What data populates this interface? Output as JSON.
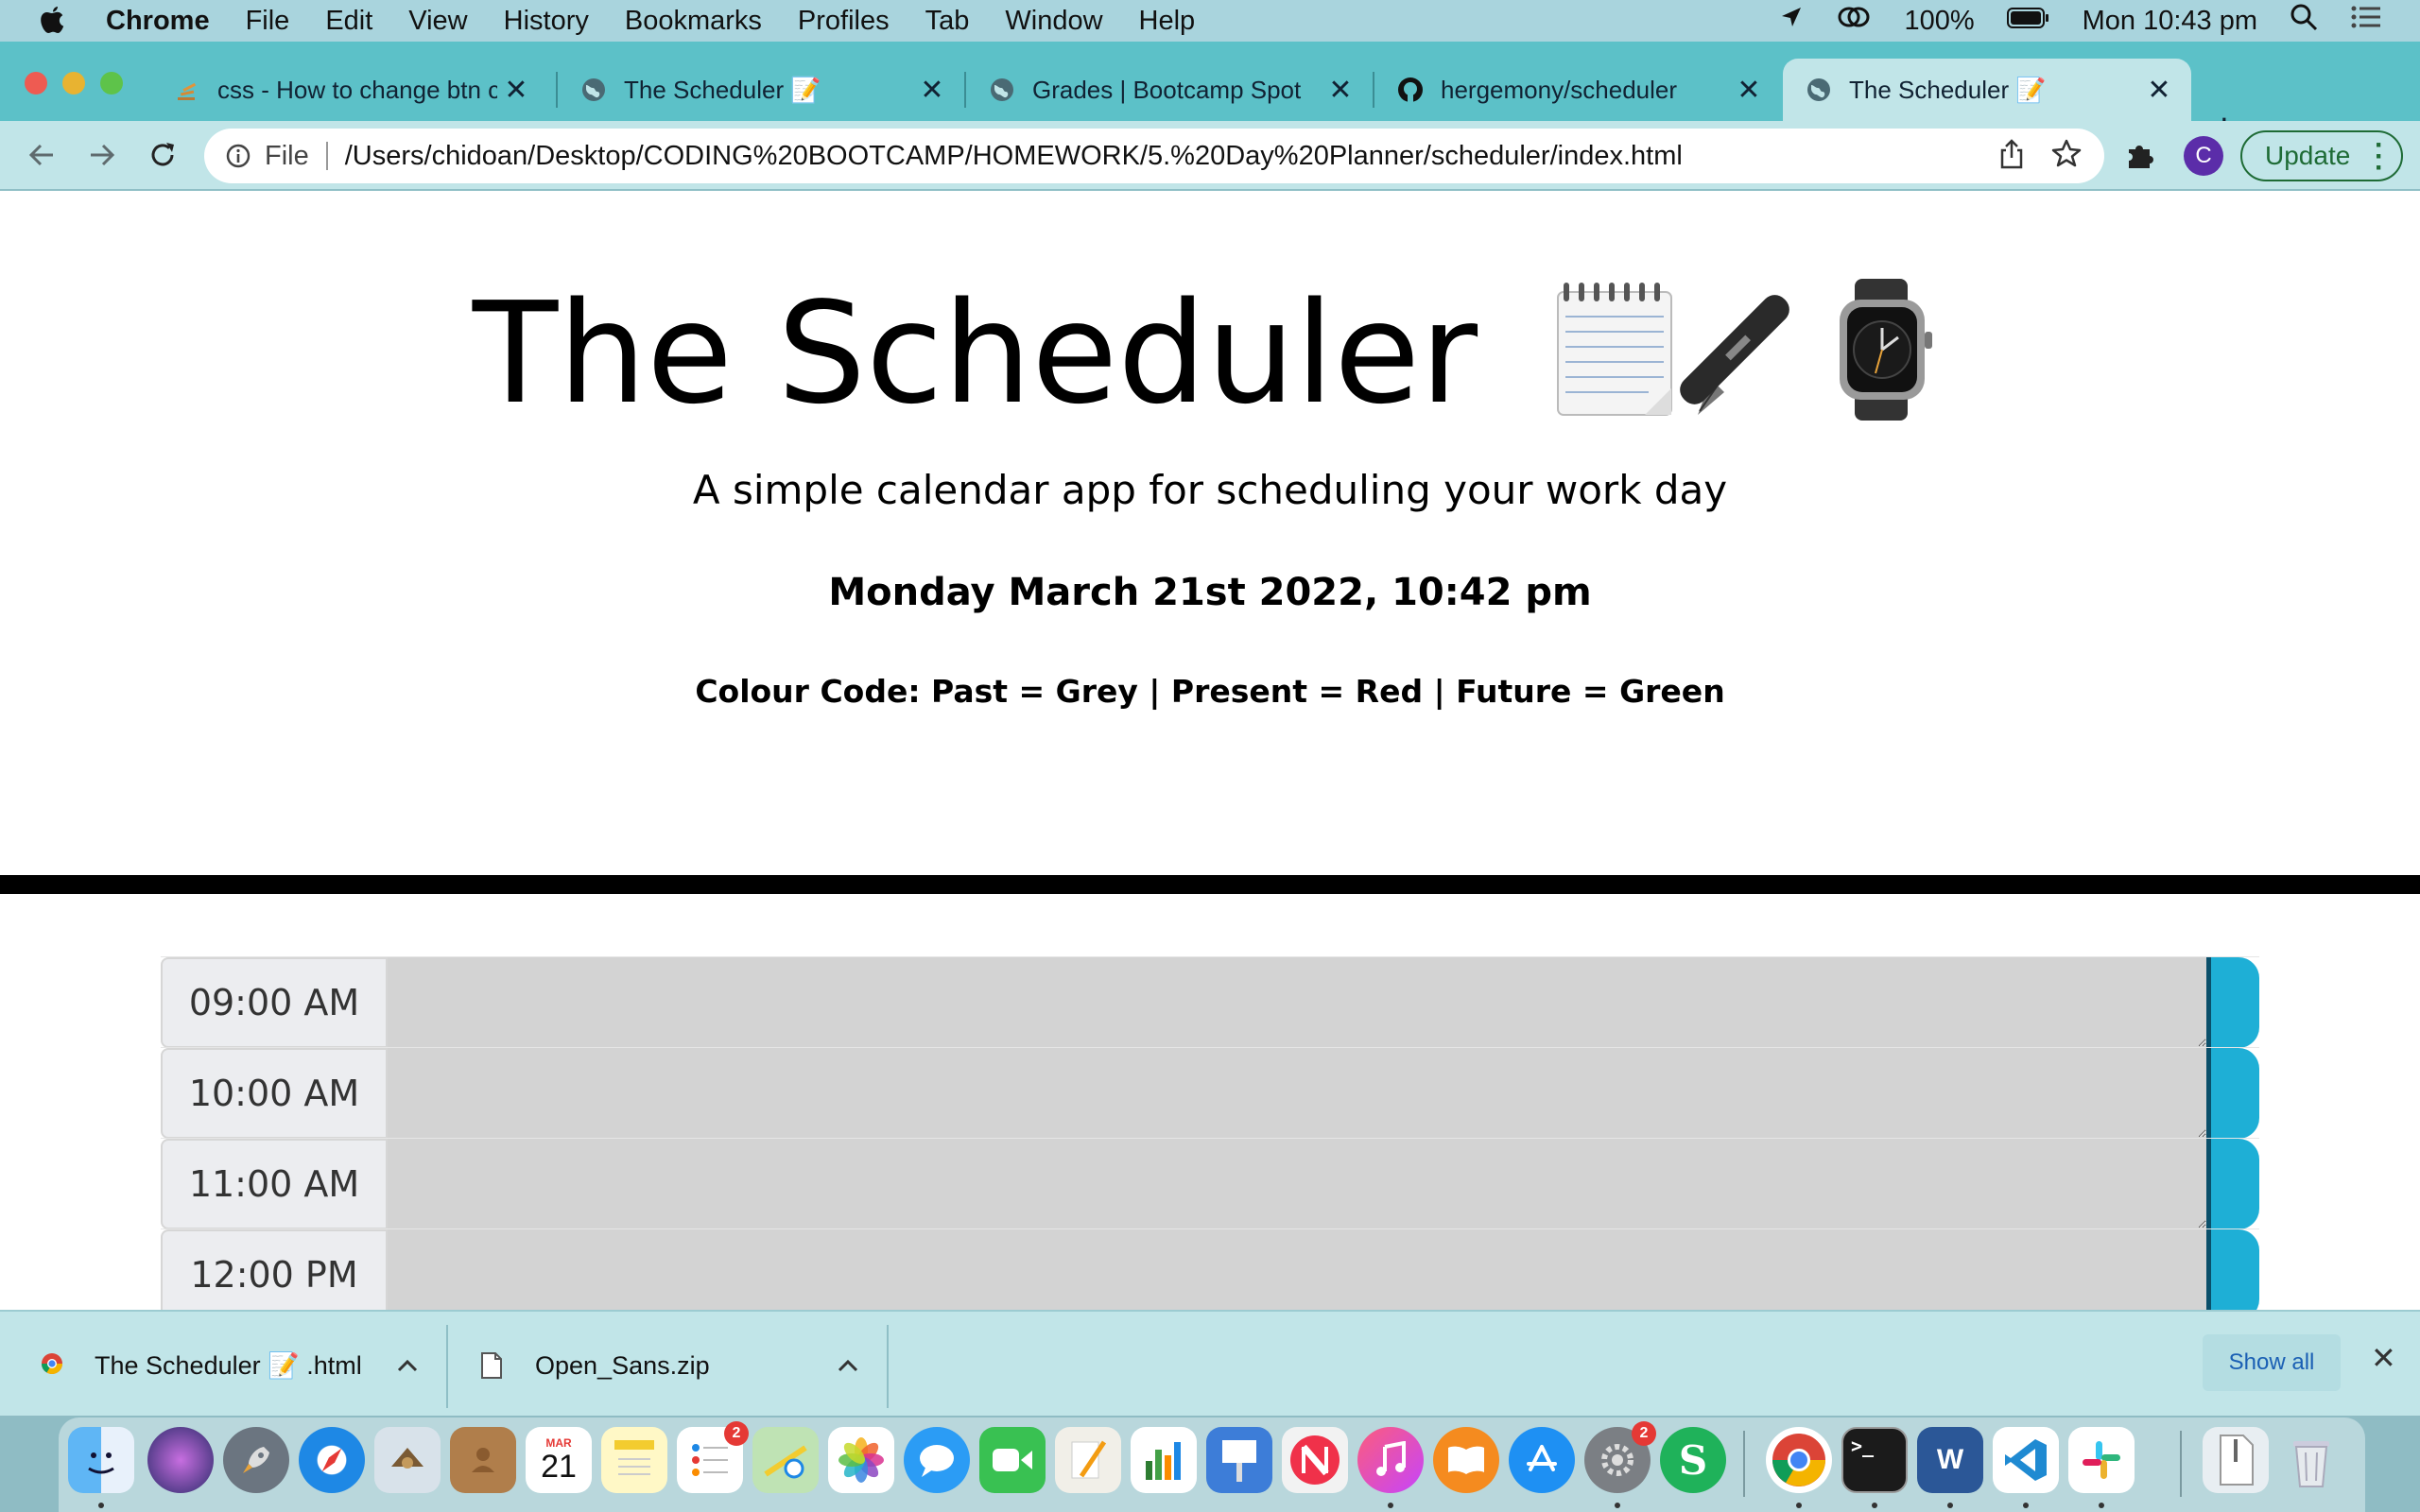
{
  "menubar": {
    "app": "Chrome",
    "items": [
      "File",
      "Edit",
      "View",
      "History",
      "Bookmarks",
      "Profiles",
      "Tab",
      "Window",
      "Help"
    ],
    "battery": "100%",
    "clock": "Mon 10:43 pm"
  },
  "tabs": [
    {
      "label": "css - How to change btn co",
      "active": false
    },
    {
      "label": "The Scheduler 📝",
      "active": false
    },
    {
      "label": "Grades | Bootcamp Spot",
      "active": false
    },
    {
      "label": "hergemony/scheduler",
      "active": false
    },
    {
      "label": "The Scheduler 📝",
      "active": true
    }
  ],
  "toolbar": {
    "scheme": "File",
    "url": "/Users/chidoan/Desktop/CODING%20BOOTCAMP/HOMEWORK/5.%20Day%20Planner/scheduler/index.html",
    "profile_initial": "C",
    "update_label": "Update"
  },
  "page": {
    "title": "The Scheduler",
    "title_emojis": "📝🖋⌚",
    "subtitle": "A simple calendar app for scheduling your work day",
    "datetime": "Monday March 21st 2022, 10:42 pm",
    "colour_code": "Colour Code: Past = Grey | Present = Red | Future = Green",
    "colors": {
      "past": "#d3d3d3",
      "save": "#1eafd6"
    },
    "hours": [
      {
        "label": "09:00 AM",
        "value": ""
      },
      {
        "label": "10:00 AM",
        "value": ""
      },
      {
        "label": "11:00 AM",
        "value": ""
      },
      {
        "label": "12:00 PM",
        "value": ""
      }
    ]
  },
  "downloads": {
    "items": [
      {
        "name": "The Scheduler 📝 .html"
      },
      {
        "name": "Open_Sans.zip"
      }
    ],
    "show_all": "Show all"
  },
  "dock": {
    "calendar_month": "MAR",
    "calendar_day": "21",
    "reminders_badge": "2",
    "prefs_badge": "2"
  }
}
